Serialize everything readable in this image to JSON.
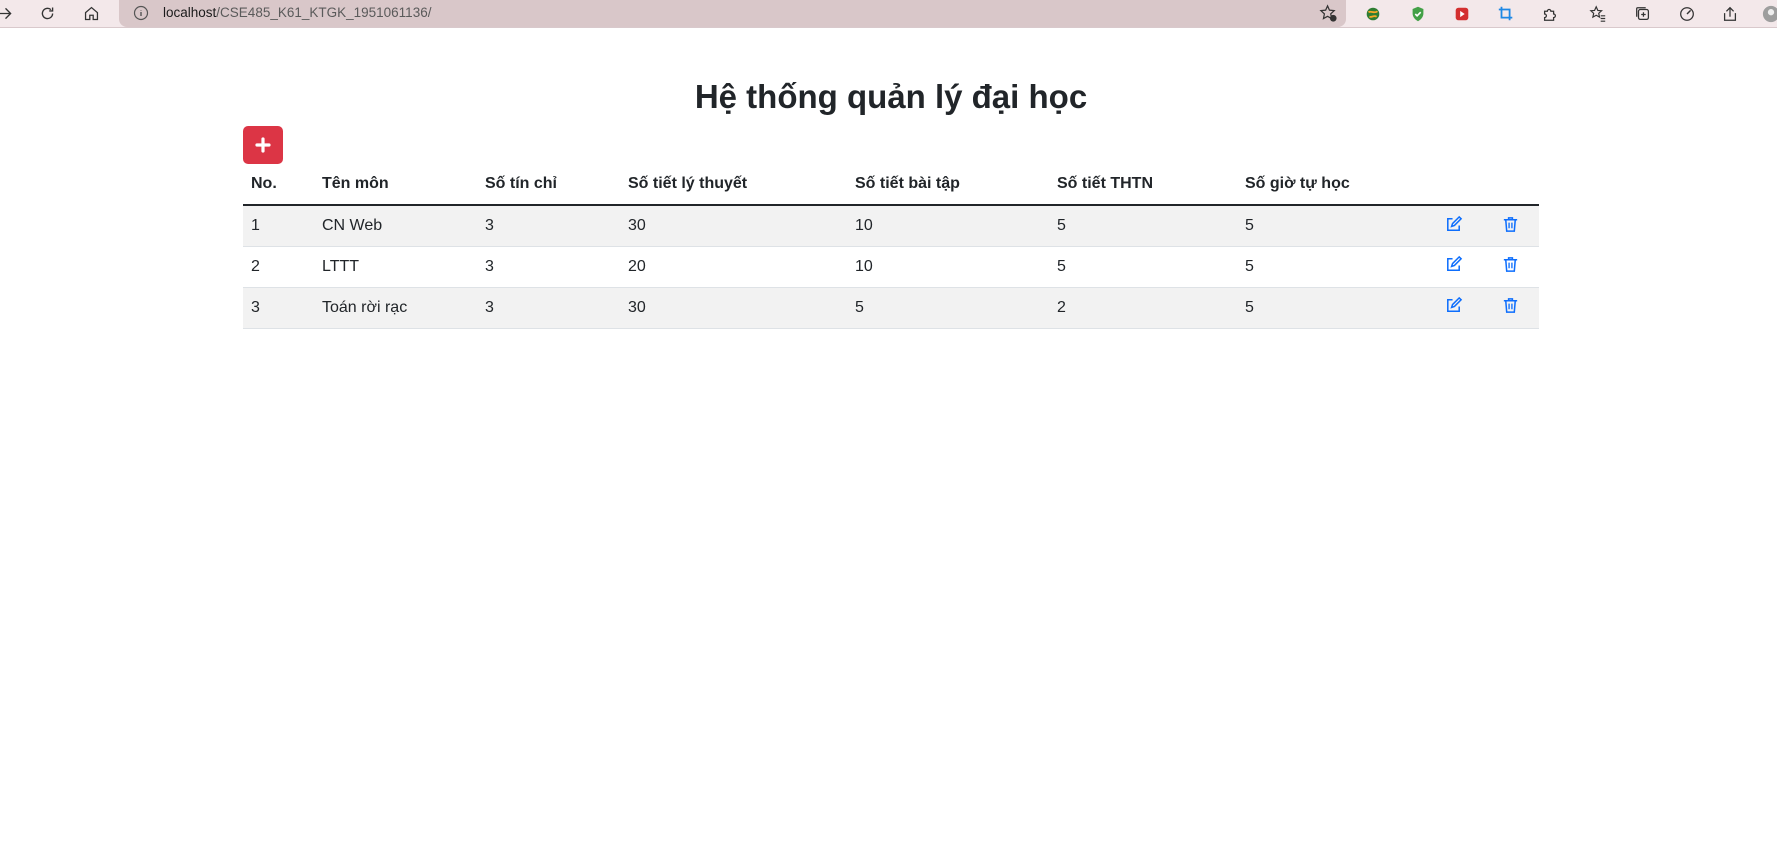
{
  "browser": {
    "url_host": "localhost",
    "url_path": "/CSE485_K61_KTGK_1951061136/"
  },
  "page": {
    "title": "Hệ thống quản lý đại học",
    "add_button_icon": "plus-icon"
  },
  "table": {
    "headers": [
      "No.",
      "Tên môn",
      "Số tín chỉ",
      "Số tiết lý thuyết",
      "Số tiết bài tập",
      "Số tiết THTN",
      "Số giờ tự học"
    ],
    "rows": [
      [
        "1",
        "CN Web",
        "3",
        "30",
        "10",
        "5",
        "5"
      ],
      [
        "2",
        "LTTT",
        "3",
        "20",
        "10",
        "5",
        "5"
      ],
      [
        "3",
        "Toán rời rạc",
        "3",
        "30",
        "5",
        "2",
        "5"
      ]
    ],
    "row_actions": [
      "edit-icon",
      "trash-icon"
    ]
  },
  "colors": {
    "add_button": "#dc3545",
    "action_icon": "#0d6efd",
    "browser_toolbar": "#f3e8ea"
  }
}
